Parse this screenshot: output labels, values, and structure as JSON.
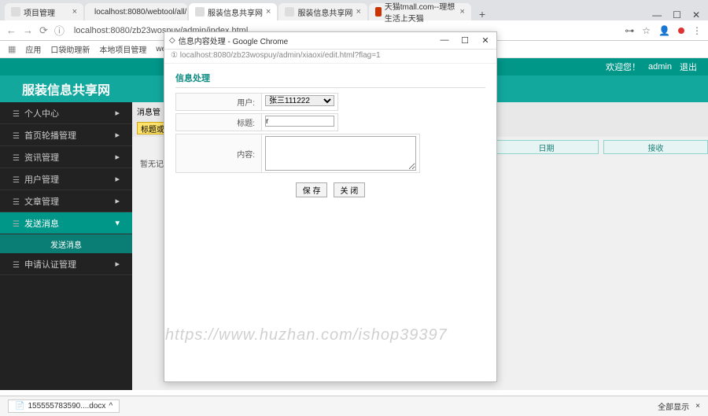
{
  "browser": {
    "tabs": [
      {
        "label": "项目管理"
      },
      {
        "label": "localhost:8080/webtool/all/"
      },
      {
        "label": "服装信息共享网"
      },
      {
        "label": "服装信息共享网"
      },
      {
        "label": "天猫tmall.com--理想生活上天猫"
      }
    ],
    "url": "localhost:8080/zb23wospuy/admin/index.html",
    "bookmarks": [
      "应用",
      "口袋助理新",
      "本地项目管理",
      "webto"
    ]
  },
  "app": {
    "welcome": "欢迎您！",
    "user": "admin",
    "logout": "退出",
    "site_title": "服装信息共享网"
  },
  "sidebar": {
    "items": [
      {
        "label": "个人中心"
      },
      {
        "label": "首页轮播管理"
      },
      {
        "label": "资讯管理"
      },
      {
        "label": "用户管理"
      },
      {
        "label": "文章管理"
      },
      {
        "label": "发送消息",
        "active": true
      },
      {
        "label": "申请认证管理"
      }
    ],
    "sub": "发送消息"
  },
  "content": {
    "tab1": "消息管",
    "yellow": "标题或接收",
    "empty": "暂无记",
    "col1": "日期",
    "col2": "接收"
  },
  "popup": {
    "title": "信息内容处理 - Google Chrome",
    "url": "① localhost:8080/zb23wospuy/admin/xiaoxi/edit.html?flag=1",
    "heading": "信息处理",
    "label_user": "用户:",
    "label_title": "标题:",
    "label_content": "内容:",
    "user_value": "张三111222",
    "title_value": "r",
    "btn_save": "保 存",
    "btn_close": "关 闭"
  },
  "watermark": "https://www.huzhan.com/ishop39397",
  "download": {
    "file": "155555783590....docx",
    "showall": "全部显示"
  }
}
